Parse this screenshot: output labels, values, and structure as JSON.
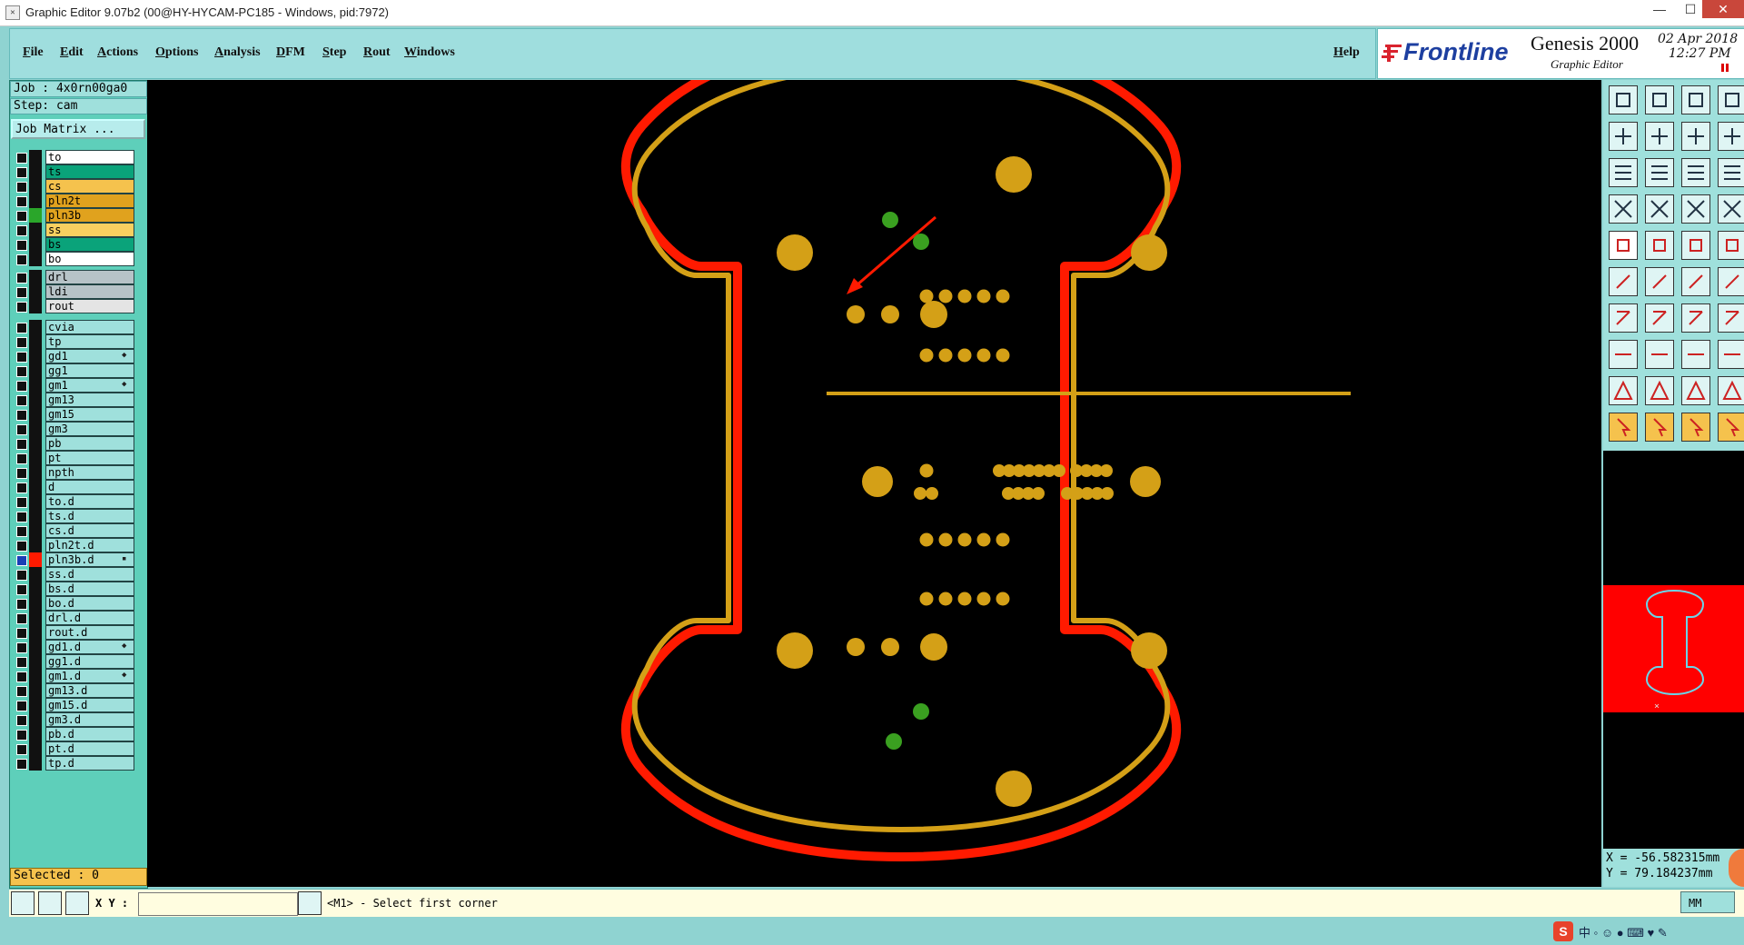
{
  "window": {
    "title": "Graphic Editor 9.07b2 (00@HY-HYCAM-PC185 - Windows, pid:7972)",
    "minimize": "—",
    "maximize": "☐",
    "close": "✕"
  },
  "menu": {
    "items": [
      "File",
      "Edit",
      "Actions",
      "Options",
      "Analysis",
      "DFM",
      "Step",
      "Rout",
      "Windows"
    ],
    "help": "Help"
  },
  "brand": {
    "logo": "Frontline",
    "product": "Genesis 2000",
    "subtitle": "Graphic Editor",
    "date": "02 Apr 2018",
    "time": "12:27 PM"
  },
  "job": {
    "job_line": "Job : 4x0rn00ga0",
    "step_line": "Step: cam",
    "matrix_button": "Job Matrix ...",
    "selected": "Selected : 0"
  },
  "layers_group1": [
    {
      "name": "to",
      "color": "#ffffff"
    },
    {
      "name": "ts",
      "color": "#0aa37a"
    },
    {
      "name": "cs",
      "color": "#f5c24d"
    },
    {
      "name": "pln2t",
      "color": "#e0a21e"
    },
    {
      "name": "pln3b",
      "color": "#e0a21e",
      "active": true
    },
    {
      "name": "ss",
      "color": "#f8d060"
    },
    {
      "name": "bs",
      "color": "#0aa37a"
    },
    {
      "name": "bo",
      "color": "#ffffff"
    }
  ],
  "layers_group2": [
    {
      "name": "drl",
      "color": "#b7c3c7"
    },
    {
      "name": "ldi",
      "color": "#b7c3c7"
    },
    {
      "name": "rout",
      "color": "#e4e4e4"
    }
  ],
  "layers_group3": [
    {
      "name": "cvia"
    },
    {
      "name": "tp"
    },
    {
      "name": "gd1",
      "icon": "◆"
    },
    {
      "name": "gg1"
    },
    {
      "name": "gm1",
      "icon": "◆"
    },
    {
      "name": "gm13"
    },
    {
      "name": "gm15"
    },
    {
      "name": "gm3"
    },
    {
      "name": "pb"
    },
    {
      "name": "pt"
    },
    {
      "name": "npth"
    },
    {
      "name": "d"
    },
    {
      "name": "to.d"
    },
    {
      "name": "ts.d"
    },
    {
      "name": "cs.d"
    },
    {
      "name": "pln2t.d"
    },
    {
      "name": "pln3b.d",
      "selected": true,
      "icon": "▪"
    },
    {
      "name": "ss.d"
    },
    {
      "name": "bs.d"
    },
    {
      "name": "bo.d"
    },
    {
      "name": "drl.d"
    },
    {
      "name": "rout.d"
    },
    {
      "name": "gd1.d",
      "icon": "◆"
    },
    {
      "name": "gg1.d"
    },
    {
      "name": "gm1.d",
      "icon": "◆"
    },
    {
      "name": "gm13.d"
    },
    {
      "name": "gm15.d"
    },
    {
      "name": "gm3.d"
    },
    {
      "name": "pb.d"
    },
    {
      "name": "pt.d"
    },
    {
      "name": "tp.d"
    }
  ],
  "coords": {
    "x": "X = -56.582315mm",
    "y": "Y = 79.184237mm"
  },
  "command": {
    "xy_label": "X Y :",
    "prompt": "<M1> - Select first corner",
    "units": "MM"
  },
  "colors": {
    "board_outline": "#ff1a00",
    "copper": "#d4a017",
    "via_green": "#3aa020",
    "thumb_outline": "#6ad5e8"
  }
}
